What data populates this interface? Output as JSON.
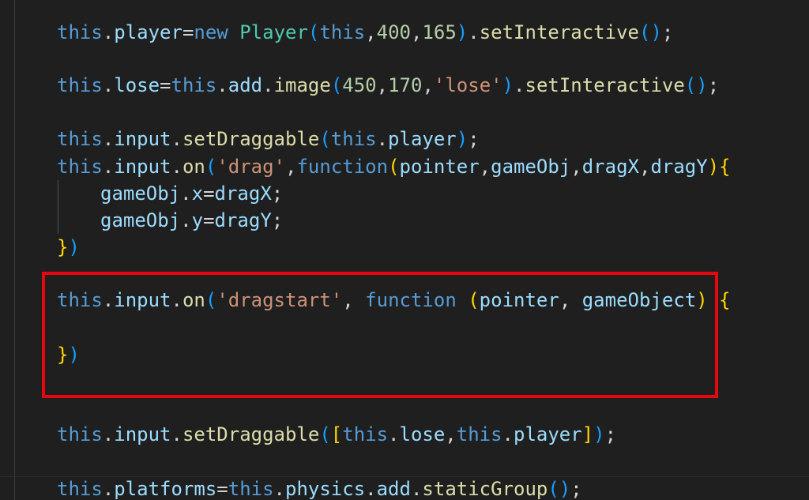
{
  "code": {
    "lines": [
      [
        {
          "t": "this",
          "c": "kw"
        },
        {
          "t": ".",
          "c": "pn"
        },
        {
          "t": "player",
          "c": "id"
        },
        {
          "t": "=",
          "c": "pn"
        },
        {
          "t": "new",
          "c": "kw"
        },
        {
          "t": " ",
          "c": "pn"
        },
        {
          "t": "Player",
          "c": "cls"
        },
        {
          "t": "(",
          "c": "p3"
        },
        {
          "t": "this",
          "c": "kw"
        },
        {
          "t": ",",
          "c": "pn"
        },
        {
          "t": "400",
          "c": "num"
        },
        {
          "t": ",",
          "c": "pn"
        },
        {
          "t": "165",
          "c": "num"
        },
        {
          "t": ")",
          "c": "p3"
        },
        {
          "t": ".",
          "c": "pn"
        },
        {
          "t": "setInteractive",
          "c": "fn"
        },
        {
          "t": "()",
          "c": "p3"
        },
        {
          "t": ";",
          "c": "pn"
        }
      ],
      [
        {
          "t": "this",
          "c": "kw"
        },
        {
          "t": ".",
          "c": "pn"
        },
        {
          "t": "lose",
          "c": "id"
        },
        {
          "t": "=",
          "c": "pn"
        },
        {
          "t": "this",
          "c": "kw"
        },
        {
          "t": ".",
          "c": "pn"
        },
        {
          "t": "add",
          "c": "id"
        },
        {
          "t": ".",
          "c": "pn"
        },
        {
          "t": "image",
          "c": "fn"
        },
        {
          "t": "(",
          "c": "p3"
        },
        {
          "t": "450",
          "c": "num"
        },
        {
          "t": ",",
          "c": "pn"
        },
        {
          "t": "170",
          "c": "num"
        },
        {
          "t": ",",
          "c": "pn"
        },
        {
          "t": "'lose'",
          "c": "str"
        },
        {
          "t": ")",
          "c": "p3"
        },
        {
          "t": ".",
          "c": "pn"
        },
        {
          "t": "setInteractive",
          "c": "fn"
        },
        {
          "t": "()",
          "c": "p3"
        },
        {
          "t": ";",
          "c": "pn"
        }
      ],
      [
        {
          "t": "this",
          "c": "kw"
        },
        {
          "t": ".",
          "c": "pn"
        },
        {
          "t": "input",
          "c": "id"
        },
        {
          "t": ".",
          "c": "pn"
        },
        {
          "t": "setDraggable",
          "c": "fn"
        },
        {
          "t": "(",
          "c": "p3"
        },
        {
          "t": "this",
          "c": "kw"
        },
        {
          "t": ".",
          "c": "pn"
        },
        {
          "t": "player",
          "c": "id"
        },
        {
          "t": ")",
          "c": "p3"
        },
        {
          "t": ";",
          "c": "pn"
        }
      ],
      [
        {
          "t": "this",
          "c": "kw"
        },
        {
          "t": ".",
          "c": "pn"
        },
        {
          "t": "input",
          "c": "id"
        },
        {
          "t": ".",
          "c": "pn"
        },
        {
          "t": "on",
          "c": "fn"
        },
        {
          "t": "(",
          "c": "p3"
        },
        {
          "t": "'drag'",
          "c": "str"
        },
        {
          "t": ",",
          "c": "pn"
        },
        {
          "t": "function",
          "c": "kw"
        },
        {
          "t": "(",
          "c": "p1"
        },
        {
          "t": "pointer",
          "c": "id"
        },
        {
          "t": ",",
          "c": "pn"
        },
        {
          "t": "gameObj",
          "c": "id"
        },
        {
          "t": ",",
          "c": "pn"
        },
        {
          "t": "dragX",
          "c": "id"
        },
        {
          "t": ",",
          "c": "pn"
        },
        {
          "t": "dragY",
          "c": "id"
        },
        {
          "t": ")",
          "c": "p1"
        },
        {
          "t": "{",
          "c": "p1"
        }
      ],
      [
        {
          "t": "gameObj",
          "c": "id"
        },
        {
          "t": ".",
          "c": "pn"
        },
        {
          "t": "x",
          "c": "id"
        },
        {
          "t": "=",
          "c": "pn"
        },
        {
          "t": "dragX",
          "c": "id"
        },
        {
          "t": ";",
          "c": "pn"
        }
      ],
      [
        {
          "t": "gameObj",
          "c": "id"
        },
        {
          "t": ".",
          "c": "pn"
        },
        {
          "t": "y",
          "c": "id"
        },
        {
          "t": "=",
          "c": "pn"
        },
        {
          "t": "dragY",
          "c": "id"
        },
        {
          "t": ";",
          "c": "pn"
        }
      ],
      [
        {
          "t": "}",
          "c": "p1"
        },
        {
          "t": ")",
          "c": "p3"
        }
      ],
      [
        {
          "t": "this",
          "c": "kw"
        },
        {
          "t": ".",
          "c": "pn"
        },
        {
          "t": "input",
          "c": "id"
        },
        {
          "t": ".",
          "c": "pn"
        },
        {
          "t": "on",
          "c": "fn"
        },
        {
          "t": "(",
          "c": "p3"
        },
        {
          "t": "'dragstart'",
          "c": "str"
        },
        {
          "t": ", ",
          "c": "pn"
        },
        {
          "t": "function",
          "c": "kw"
        },
        {
          "t": " ",
          "c": "pn"
        },
        {
          "t": "(",
          "c": "p1"
        },
        {
          "t": "pointer",
          "c": "id"
        },
        {
          "t": ", ",
          "c": "pn"
        },
        {
          "t": "gameObject",
          "c": "id"
        },
        {
          "t": ")",
          "c": "p1"
        },
        {
          "t": " ",
          "c": "pn"
        },
        {
          "t": "{",
          "c": "p1"
        }
      ],
      [
        {
          "t": "}",
          "c": "p1"
        },
        {
          "t": ")",
          "c": "p3"
        }
      ],
      [
        {
          "t": "this",
          "c": "kw"
        },
        {
          "t": ".",
          "c": "pn"
        },
        {
          "t": "input",
          "c": "id"
        },
        {
          "t": ".",
          "c": "pn"
        },
        {
          "t": "setDraggable",
          "c": "fn"
        },
        {
          "t": "(",
          "c": "p3"
        },
        {
          "t": "[",
          "c": "p1"
        },
        {
          "t": "this",
          "c": "kw"
        },
        {
          "t": ".",
          "c": "pn"
        },
        {
          "t": "lose",
          "c": "id"
        },
        {
          "t": ",",
          "c": "pn"
        },
        {
          "t": "this",
          "c": "kw"
        },
        {
          "t": ".",
          "c": "pn"
        },
        {
          "t": "player",
          "c": "id"
        },
        {
          "t": "]",
          "c": "p1"
        },
        {
          "t": ")",
          "c": "p3"
        },
        {
          "t": ";",
          "c": "pn"
        }
      ],
      [
        {
          "t": "this",
          "c": "kw"
        },
        {
          "t": ".",
          "c": "pn"
        },
        {
          "t": "platforms",
          "c": "id"
        },
        {
          "t": "=",
          "c": "pn"
        },
        {
          "t": "this",
          "c": "kw"
        },
        {
          "t": ".",
          "c": "pn"
        },
        {
          "t": "physics",
          "c": "id"
        },
        {
          "t": ".",
          "c": "pn"
        },
        {
          "t": "add",
          "c": "id"
        },
        {
          "t": ".",
          "c": "pn"
        },
        {
          "t": "staticGroup",
          "c": "fn"
        },
        {
          "t": "()",
          "c": "p3"
        },
        {
          "t": ";",
          "c": "pn"
        }
      ]
    ]
  },
  "theme": {
    "background": "#1f1f1f",
    "highlight_border": "#e8070f"
  }
}
